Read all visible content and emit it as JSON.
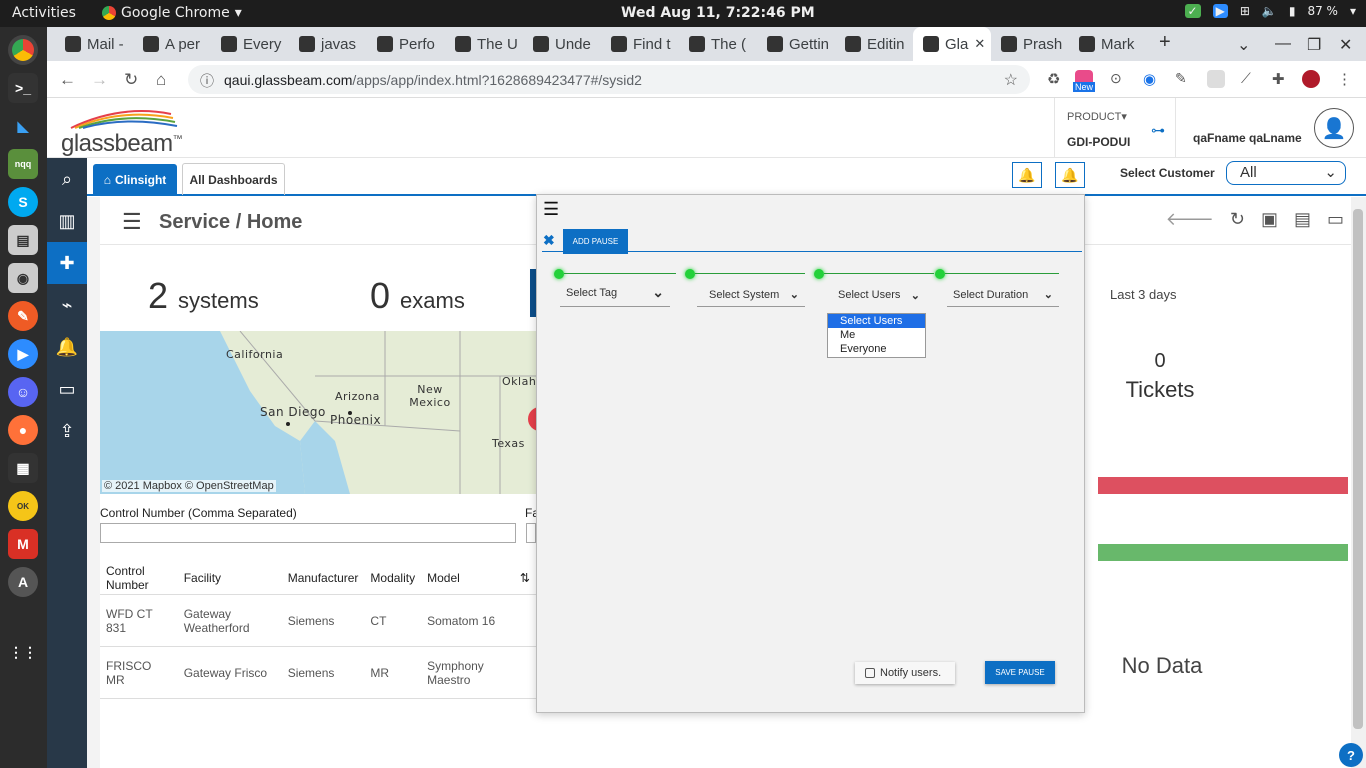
{
  "os": {
    "activities": "Activities",
    "app_name": "Google Chrome",
    "clock": "Wed Aug 11,  7:22:46 PM",
    "battery": "87 %"
  },
  "browser": {
    "tabs": [
      {
        "label": "Mail -",
        "icon": "outlook-icon"
      },
      {
        "label": "A per",
        "icon": "medium-icon"
      },
      {
        "label": "Every",
        "icon": "medium-icon"
      },
      {
        "label": "javas",
        "icon": "stackoverflow-icon"
      },
      {
        "label": "Perfo",
        "icon": "globe-icon"
      },
      {
        "label": "The U",
        "icon": "medium-icon"
      },
      {
        "label": "Unde",
        "icon": "medium-icon"
      },
      {
        "label": "Find t",
        "icon": "code-icon"
      },
      {
        "label": "The (",
        "icon": "dev-icon"
      },
      {
        "label": "Gettin",
        "icon": "globe-icon"
      },
      {
        "label": "Editin",
        "icon": "github-icon"
      },
      {
        "label": "Gla",
        "icon": "glassbeam-icon"
      },
      {
        "label": "Prash",
        "icon": "dev-icon"
      },
      {
        "label": "Mark",
        "icon": "board-icon"
      }
    ],
    "url_host": "qaui.glassbeam.com",
    "url_rest": "/apps/app/index.html?1628689423477#/sysid2",
    "ext_new_badge": "New"
  },
  "app": {
    "logo_text": "glassbeam",
    "logo_tm": "™",
    "product_label": "PRODUCT",
    "product_value": "GDI-PODUI",
    "user_name": "qaFname qaLname",
    "tab_clinsight": "Clinsight",
    "tab_all_dashboards": "All Dashboards",
    "select_customer_label": "Select Customer",
    "select_customer_value": "All",
    "page_title": "Service / Home",
    "systems_count": "2",
    "systems_label": "systems",
    "exams_count": "0",
    "exams_label": "exams",
    "last_days": "Last 3 days",
    "tickets_count": "0",
    "tickets_label": "Tickets",
    "no_data": "No Data",
    "control_number_label": "Control Number (Comma Separated)",
    "facility_label_partial": "Fa",
    "map": {
      "attribution": "© 2021 Mapbox  © OpenStreetMap",
      "labels": [
        "California",
        "Arizona",
        "New Mexico",
        "Oklah",
        "San Diego",
        "Phoenix",
        "Texas"
      ]
    },
    "table": {
      "headers": [
        "Control Number",
        "Facility",
        "Manufacturer",
        "Modality",
        "Model",
        "⇅"
      ],
      "rows": [
        [
          "WFD CT 831",
          "Gateway Weatherford",
          "Siemens",
          "CT",
          "Somatom 16"
        ],
        [
          "FRISCO MR",
          "Gateway Frisco",
          "Siemens",
          "MR",
          "Symphony Maestro"
        ]
      ]
    },
    "help": "?"
  },
  "modal": {
    "add_pause": "ADD PAUSE",
    "steps": [
      {
        "label": "Select Tag"
      },
      {
        "label": "Select System"
      },
      {
        "label": "Select Users"
      },
      {
        "label": "Select Duration"
      }
    ],
    "users_options": [
      "Select Users",
      "Me",
      "Everyone"
    ],
    "notify_label": "Notify users.",
    "save_pause": "SAVE PAUSE"
  },
  "colors": {
    "accent": "#0d6fc4",
    "step_dot": "#23d13a",
    "red_bar": "#dd5060",
    "green_bar": "#68b86b"
  }
}
